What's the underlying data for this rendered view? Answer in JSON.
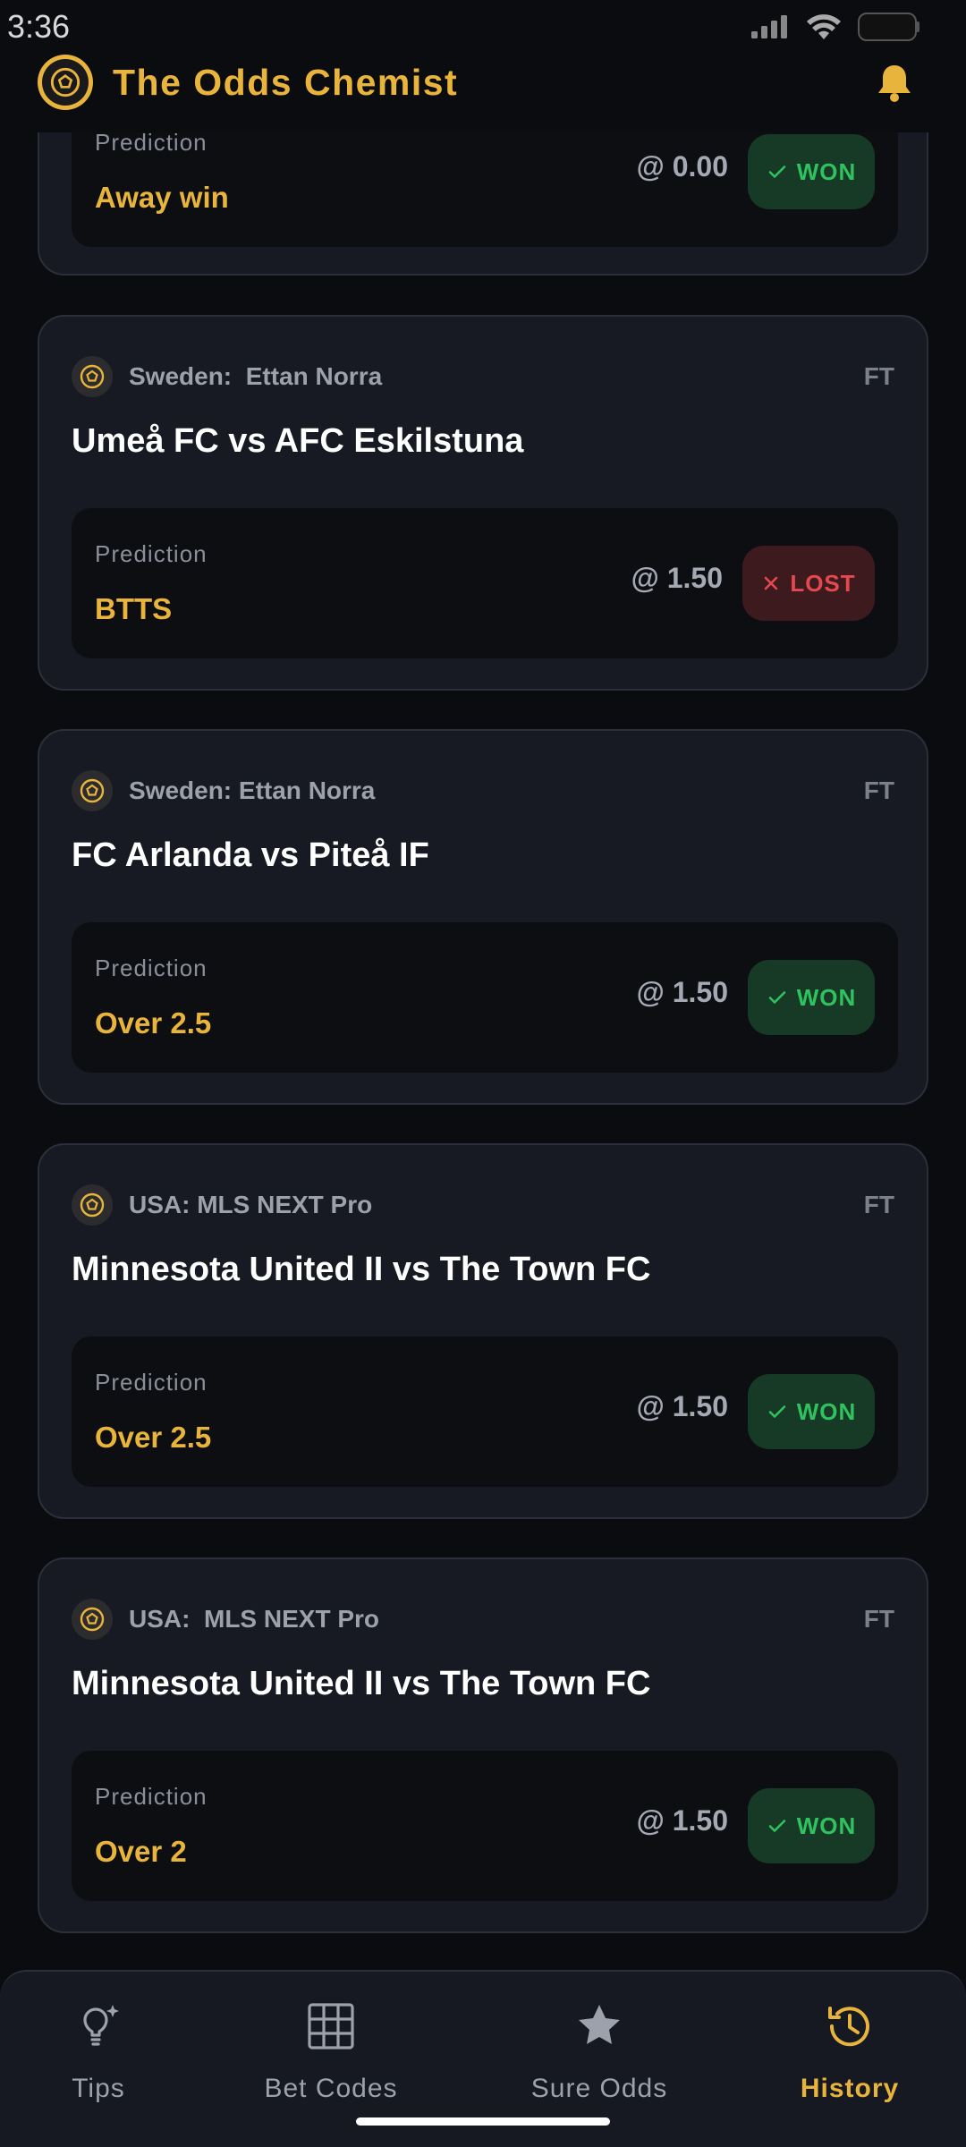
{
  "status_bar": {
    "time": "3:36"
  },
  "header": {
    "title": "The Odds Chemist"
  },
  "cards": [
    {
      "league": "",
      "status": "",
      "match": "",
      "prediction_label": "Prediction",
      "prediction": "Away win",
      "odds": "@ 0.00",
      "result": "WON",
      "result_type": "won"
    },
    {
      "league": "Sweden:  Ettan Norra",
      "status": "FT",
      "match": "Umeå FC vs AFC Eskilstuna",
      "prediction_label": "Prediction",
      "prediction": "BTTS",
      "odds": "@ 1.50",
      "result": "LOST",
      "result_type": "lost"
    },
    {
      "league": "Sweden: Ettan Norra",
      "status": "FT",
      "match": "FC Arlanda vs Piteå IF",
      "prediction_label": "Prediction",
      "prediction": "Over 2.5",
      "odds": "@ 1.50",
      "result": "WON",
      "result_type": "won"
    },
    {
      "league": "USA: MLS NEXT Pro",
      "status": "FT",
      "match": "Minnesota United II vs The Town FC",
      "prediction_label": "Prediction",
      "prediction": "Over 2.5",
      "odds": "@ 1.50",
      "result": "WON",
      "result_type": "won"
    },
    {
      "league": "USA:  MLS NEXT Pro",
      "status": "FT",
      "match": "Minnesota United II vs The Town FC",
      "prediction_label": "Prediction",
      "prediction": "Over 2",
      "odds": "@ 1.50",
      "result": "WON",
      "result_type": "won"
    }
  ],
  "bottom_nav": {
    "items": [
      {
        "label": "Tips",
        "icon": "lightbulb-sparkle-icon",
        "active": false
      },
      {
        "label": "Bet Codes",
        "icon": "grid-icon",
        "active": false
      },
      {
        "label": "Sure Odds",
        "icon": "star-icon",
        "active": false
      },
      {
        "label": "History",
        "icon": "history-icon",
        "active": true
      }
    ]
  },
  "colors": {
    "accent": "#e8b43c",
    "background": "#0b0c10",
    "card": "#171a22",
    "won": "#2fc25f",
    "lost": "#e5484d"
  }
}
